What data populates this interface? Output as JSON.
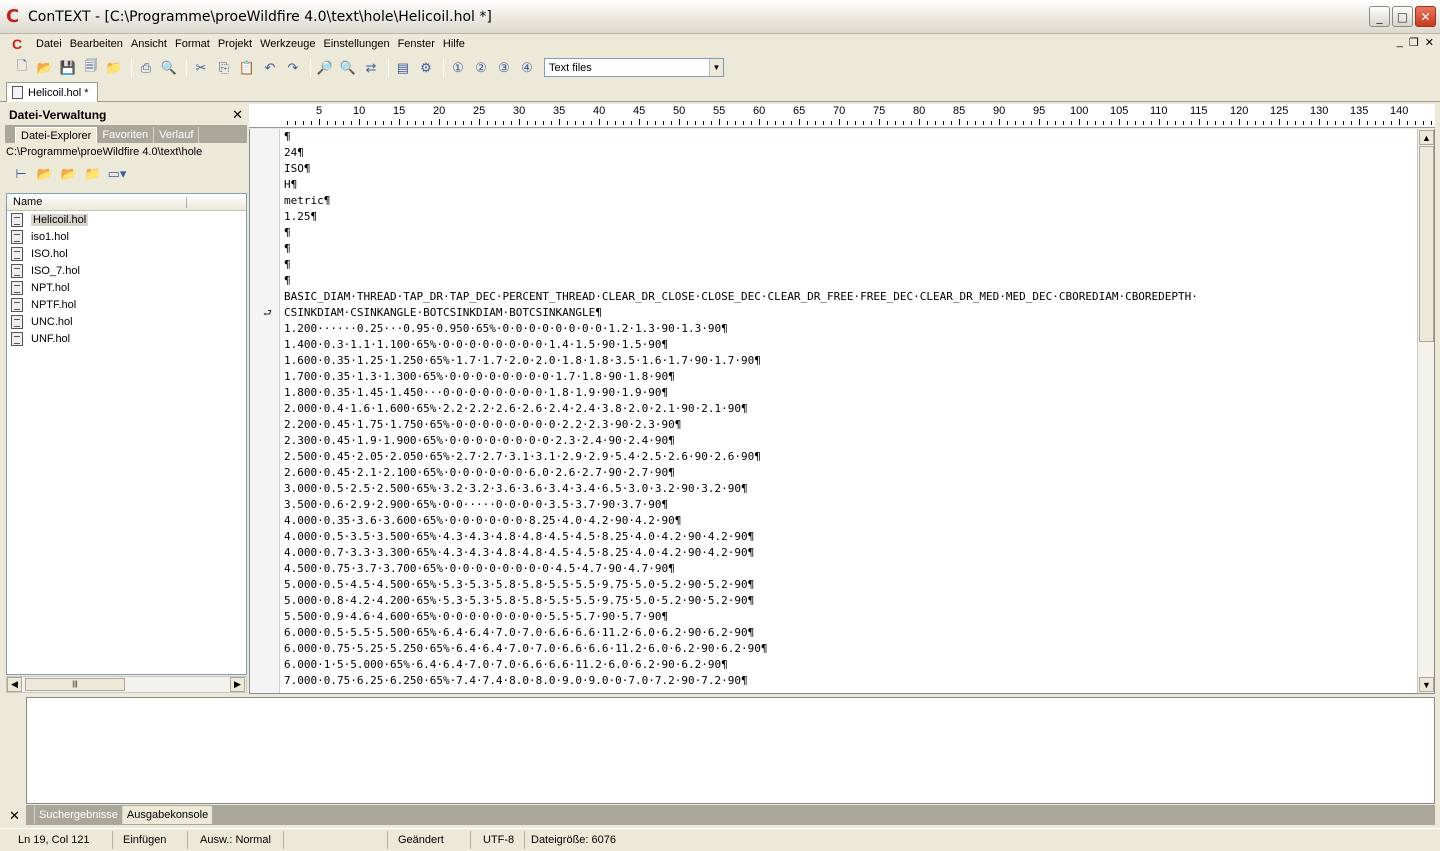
{
  "window": {
    "title": "ConTEXT - [C:\\Programme\\proeWildfire 4.0\\text\\hole\\Helicoil.hol *]"
  },
  "menu": {
    "items": [
      "Datei",
      "Bearbeiten",
      "Ansicht",
      "Format",
      "Projekt",
      "Werkzeuge",
      "Einstellungen",
      "Fenster",
      "Hilfe"
    ]
  },
  "toolbar": {
    "filetype": "Text files",
    "icons": [
      "new-file-icon",
      "open-file-icon",
      "save-icon",
      "save-all-icon",
      "open-folder-icon",
      "print-icon",
      "print-preview-icon",
      "cut-icon",
      "copy-icon",
      "paste-icon",
      "undo-icon",
      "redo-icon",
      "find-icon",
      "find-next-icon",
      "replace-icon",
      "toggle-panel-icon",
      "options-icon",
      "user-cmd-1-icon",
      "user-cmd-2-icon",
      "user-cmd-3-icon",
      "user-cmd-4-icon"
    ]
  },
  "doc_tab": {
    "label": "Helicoil.hol *"
  },
  "file_manager": {
    "title": "Datei-Verwaltung",
    "tabs": [
      "Datei-Explorer",
      "Favoriten",
      "Verlauf"
    ],
    "path": "C:\\Programme\\proeWildfire 4.0\\text\\hole",
    "column_name": "Name",
    "files": [
      "Helicoil.hol",
      "iso1.hol",
      "ISO.hol",
      "ISO_7.hol",
      "NPT.hol",
      "NPTF.hol",
      "UNC.hol",
      "UNF.hol"
    ]
  },
  "ruler": {
    "labels": [
      "5",
      "10",
      "15",
      "20",
      "25",
      "30",
      "35",
      "40",
      "45",
      "50",
      "55",
      "60",
      "65",
      "70",
      "75",
      "80",
      "85",
      "90",
      "95",
      "100",
      "105",
      "110",
      "115",
      "120",
      "125",
      "130",
      "135",
      "140"
    ]
  },
  "editor": {
    "lines": [
      "¶",
      "24¶",
      "ISO¶",
      "H¶",
      "metric¶",
      "1.25¶",
      "¶",
      "¶",
      "¶",
      "¶",
      "BASIC_DIAM·THREAD·TAP_DR·TAP_DEC·PERCENT_THREAD·CLEAR_DR_CLOSE·CLOSE_DEC·CLEAR_DR_FREE·FREE_DEC·CLEAR_DR_MED·MED_DEC·CBOREDIAM·CBOREDEPTH·",
      "CSINKDIAM·CSINKANGLE·BOTCSINKDIAM·BOTCSINKANGLE¶",
      "1.200······0.25···0.95·0.950·65%·0·0·0·0·0·0·0·0·1.2·1.3·90·1.3·90¶",
      "1.400·0.3·1.1·1.100·65%·0·0·0·0·0·0·0·0·1.4·1.5·90·1.5·90¶",
      "1.600·0.35·1.25·1.250·65%·1.7·1.7·2.0·2.0·1.8·1.8·3.5·1.6·1.7·90·1.7·90¶",
      "1.700·0.35·1.3·1.300·65%·0·0·0·0·0·0·0·0·1.7·1.8·90·1.8·90¶",
      "1.800·0.35·1.45·1.450···0·0·0·0·0·0·0·0·1.8·1.9·90·1.9·90¶",
      "2.000·0.4·1.6·1.600·65%·2.2·2.2·2.6·2.6·2.4·2.4·3.8·2.0·2.1·90·2.1·90¶",
      "2.200·0.45·1.75·1.750·65%·0·0·0·0·0·0·0·0·2.2·2.3·90·2.3·90¶",
      "2.300·0.45·1.9·1.900·65%·0·0·0·0·0·0·0·0·2.3·2.4·90·2.4·90¶",
      "2.500·0.45·2.05·2.050·65%·2.7·2.7·3.1·3.1·2.9·2.9·5.4·2.5·2.6·90·2.6·90¶",
      "2.600·0.45·2.1·2.100·65%·0·0·0·0·0·0·6.0·2.6·2.7·90·2.7·90¶",
      "3.000·0.5·2.5·2.500·65%·3.2·3.2·3.6·3.6·3.4·3.4·6.5·3.0·3.2·90·3.2·90¶",
      "3.500·0.6·2.9·2.900·65%·0·0·····0·0·0·0·3.5·3.7·90·3.7·90¶",
      "4.000·0.35·3.6·3.600·65%·0·0·0·0·0·0·8.25·4.0·4.2·90·4.2·90¶",
      "4.000·0.5·3.5·3.500·65%·4.3·4.3·4.8·4.8·4.5·4.5·8.25·4.0·4.2·90·4.2·90¶",
      "4.000·0.7·3.3·3.300·65%·4.3·4.3·4.8·4.8·4.5·4.5·8.25·4.0·4.2·90·4.2·90¶",
      "4.500·0.75·3.7·3.700·65%·0·0·0·0·0·0·0·0·4.5·4.7·90·4.7·90¶",
      "5.000·0.5·4.5·4.500·65%·5.3·5.3·5.8·5.8·5.5·5.5·9.75·5.0·5.2·90·5.2·90¶",
      "5.000·0.8·4.2·4.200·65%·5.3·5.3·5.8·5.8·5.5·5.5·9.75·5.0·5.2·90·5.2·90¶",
      "5.500·0.9·4.6·4.600·65%·0·0·0·0·0·0·0·0·5.5·5.7·90·5.7·90¶",
      "6.000·0.5·5.5·5.500·65%·6.4·6.4·7.0·7.0·6.6·6.6·11.2·6.0·6.2·90·6.2·90¶",
      "6.000·0.75·5.25·5.250·65%·6.4·6.4·7.0·7.0·6.6·6.6·11.2·6.0·6.2·90·6.2·90¶",
      "6.000·1·5·5.000·65%·6.4·6.4·7.0·7.0·6.6·6.6·11.2·6.0·6.2·90·6.2·90¶",
      "7.000·0.75·6.25·6.250·65%·7.4·7.4·8.0·8.0·9.0·9.0·0·7.0·7.2·90·7.2·90¶"
    ]
  },
  "output": {
    "tabs": [
      "Suchergebnisse",
      "Ausgabekonsole"
    ]
  },
  "status": {
    "position": "Ln 19, Col 121",
    "mode": "Einfügen",
    "selection": "Ausw.: Normal",
    "modified": "Geändert",
    "encoding": "UTF-8",
    "filesize": "Dateigröße: 6076"
  }
}
